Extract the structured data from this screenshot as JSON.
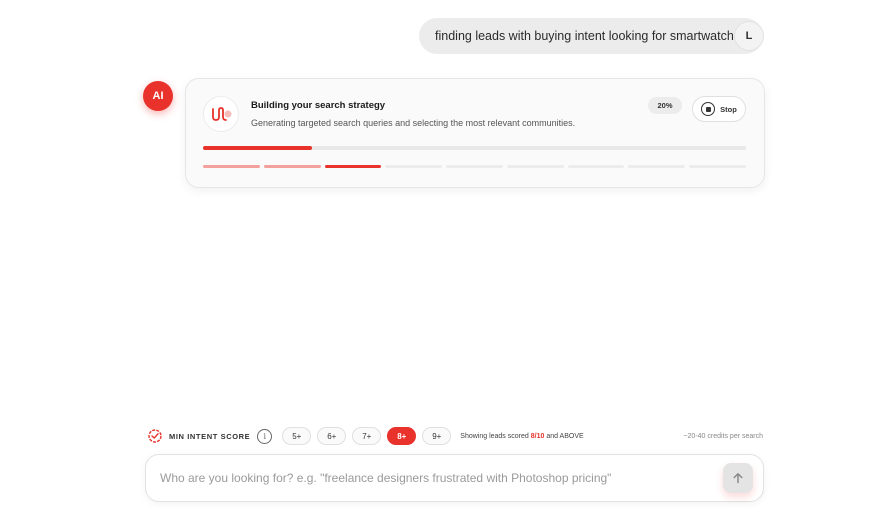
{
  "user_message": {
    "text": "finding leads with buying intent looking for smartwatches",
    "avatar_initial": "L"
  },
  "ai": {
    "avatar_label": "AI",
    "card": {
      "title": "Building your search strategy",
      "subtitle": "Generating targeted search queries and selecting the most relevant communities.",
      "progress_label": "20%",
      "progress_fraction": 0.2,
      "stop_label": "Stop",
      "steps": [
        "done",
        "done",
        "active",
        "pending",
        "pending",
        "pending",
        "pending",
        "pending",
        "pending"
      ]
    }
  },
  "intent": {
    "label": "MIN INTENT SCORE",
    "info_glyph": "i",
    "options": [
      "5+",
      "6+",
      "7+",
      "8+",
      "9+"
    ],
    "selected": "8+",
    "showing_prefix": "Showing leads scored",
    "showing_value": "8/10",
    "showing_suffix": "and ABOVE",
    "credits_text": "~20-40 credits per search"
  },
  "composer": {
    "placeholder": "Who are you looking for? e.g. \"freelance designers frustrated with Photoshop pricing\"",
    "value": ""
  },
  "colors": {
    "accent": "#e8322b",
    "accent_light": "#f3a19c",
    "bubble": "#ececec"
  },
  "icons": {
    "strategy": "search-strategy-icon",
    "stop": "stop-icon",
    "intent": "target-badge-icon",
    "info": "info-icon",
    "send": "arrow-up-icon"
  }
}
